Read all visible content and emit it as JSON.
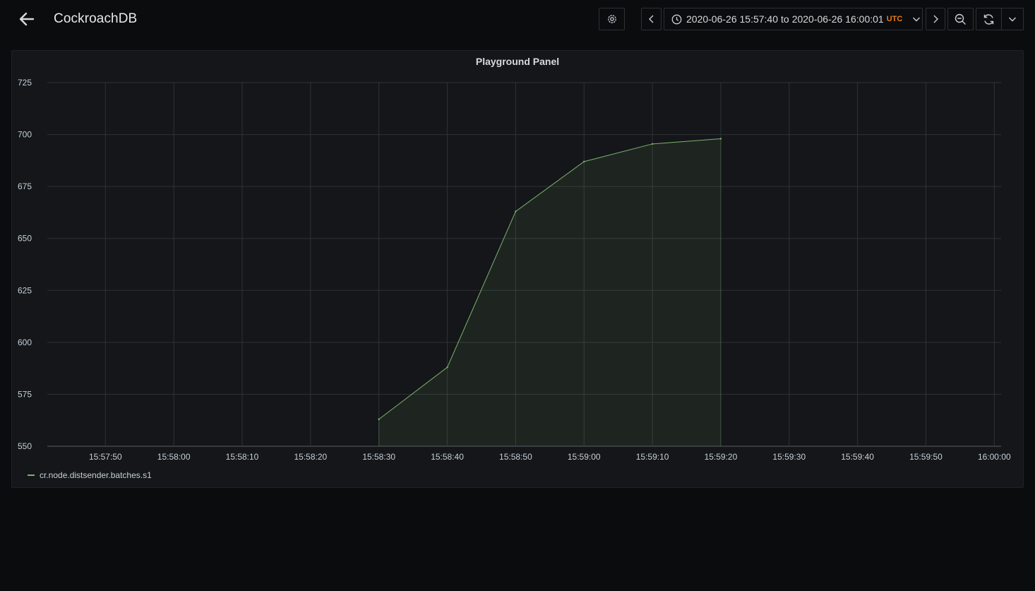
{
  "app": {
    "title": "CockroachDB"
  },
  "toolbar": {
    "time_range_from": "2020-06-26 15:57:40",
    "time_range_sep": "to",
    "time_range_to": "2020-06-26 16:00:01",
    "timezone": "UTC",
    "icons": {
      "back": "arrow-left-icon",
      "settings": "gear-icon",
      "prev": "chevron-left-icon",
      "clock": "clock-icon",
      "dropdown": "chevron-down-icon",
      "next": "chevron-right-icon",
      "zoom_out": "zoom-out-icon",
      "refresh": "refresh-icon",
      "refresh_dropdown": "chevron-down-icon"
    }
  },
  "panel": {
    "title": "Playground Panel"
  },
  "chart_data": {
    "type": "area",
    "title": "Playground Panel",
    "xlabel": "",
    "ylabel": "",
    "ylim": [
      550,
      725
    ],
    "xlim": [
      "15:57:41.5",
      "16:00:01"
    ],
    "y_ticks": [
      550,
      575,
      600,
      625,
      650,
      675,
      700,
      725
    ],
    "x_ticks": [
      "15:57:50",
      "15:58:00",
      "15:58:10",
      "15:58:20",
      "15:58:30",
      "15:58:40",
      "15:58:50",
      "15:59:00",
      "15:59:10",
      "15:59:20",
      "15:59:30",
      "15:59:40",
      "15:59:50",
      "16:00:00"
    ],
    "grid": true,
    "legend_position": "bottom-left",
    "series": [
      {
        "name": "cr.node.distsender.batches.s1",
        "color": "#7eb26d",
        "x": [
          "15:58:30",
          "15:58:40",
          "15:58:50",
          "15:59:00",
          "15:59:10",
          "15:59:20"
        ],
        "y": [
          563,
          588,
          663,
          687,
          695.5,
          698
        ]
      }
    ]
  }
}
